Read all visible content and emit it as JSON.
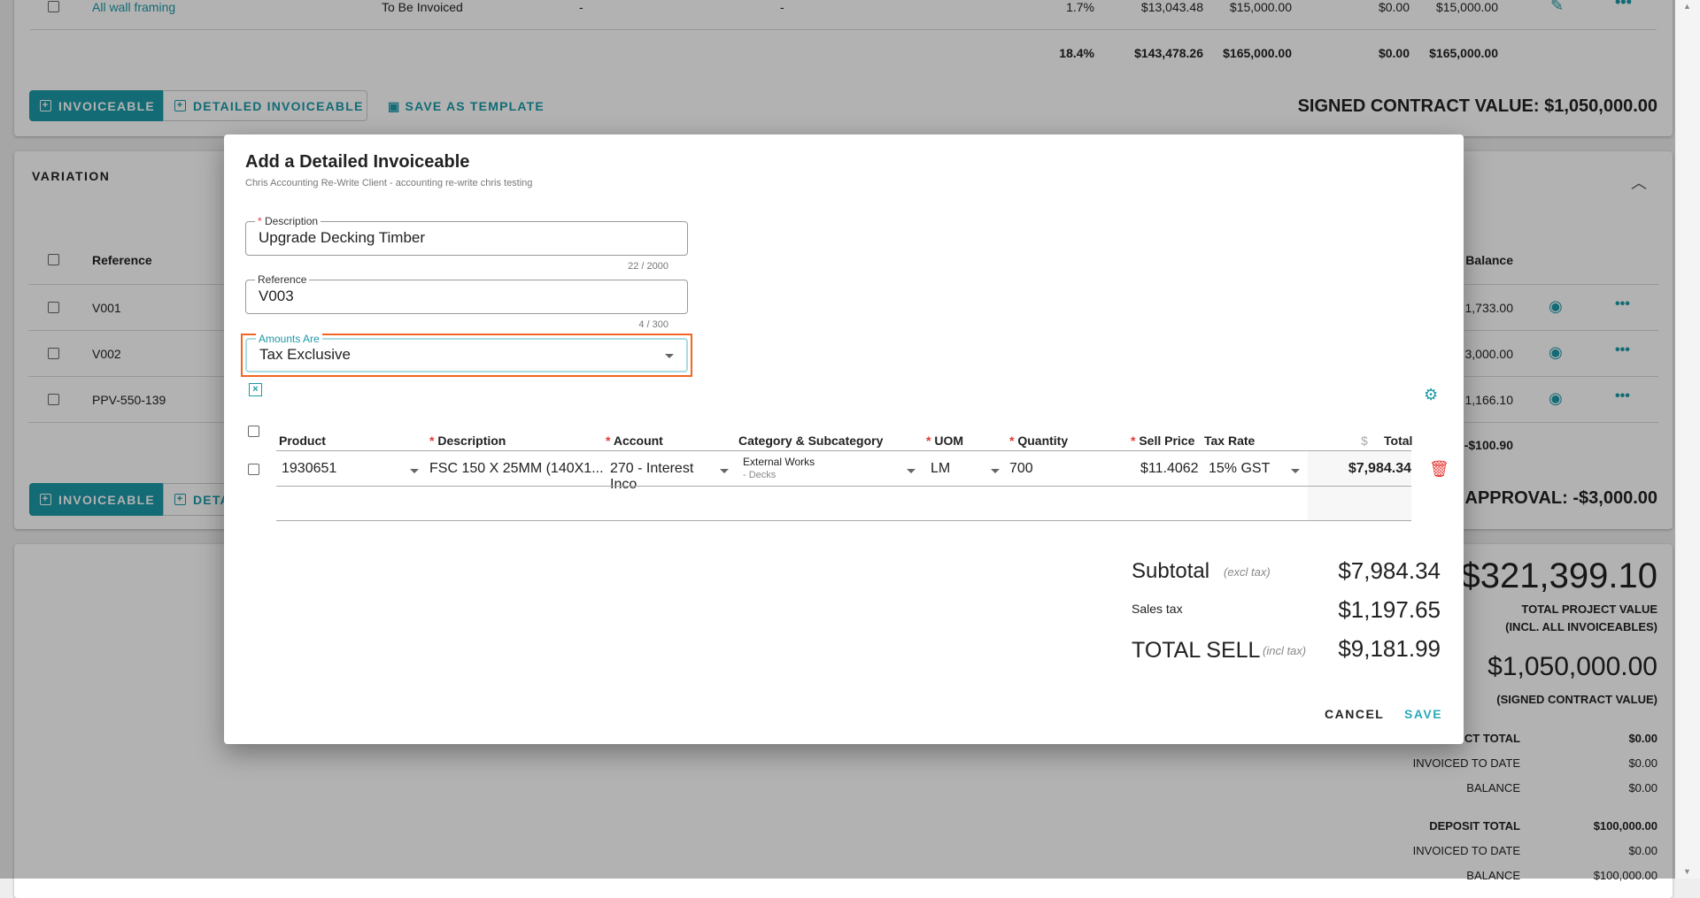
{
  "background": {
    "top_row": {
      "name": "All wall framing",
      "status": "To Be Invoiced",
      "col3": "-",
      "col4": "-",
      "pct": "1.7%",
      "cost": "$13,043.48",
      "sell": "$15,000.00",
      "invoiced": "$0.00",
      "balance": "$15,000.00"
    },
    "top_totals": {
      "pct": "18.4%",
      "cost": "$143,478.26",
      "sell": "$165,000.00",
      "invoiced": "$0.00",
      "balance": "$165,000.00"
    },
    "buttons": {
      "invoiceable": "INVOICEABLE",
      "detailed": "DETAILED INVOICEABLE",
      "detailed_partial": "DETA",
      "save_template": "SAVE AS TEMPLATE"
    },
    "signed_contract": "SIGNED CONTRACT VALUE: $1,050,000.00",
    "variation": {
      "title": "VARIATION",
      "headers": {
        "reference": "Reference",
        "balance": "Balance"
      },
      "rows": [
        {
          "ref": "V001",
          "balance": "1,733.00"
        },
        {
          "ref": "V002",
          "balance": "3,000.00"
        },
        {
          "ref": "PPV-550-139",
          "balance": "1,166.10"
        }
      ],
      "total": "-$100.90",
      "approval": "APPROVAL: -$3,000.00"
    },
    "summary": {
      "total_project_value": "$321,399.10",
      "tpv_label1": "TOTAL PROJECT VALUE",
      "tpv_label2": "(INCL. ALL INVOICEABLES)",
      "signed_value": "$1,050,000.00",
      "signed_label": "(SIGNED CONTRACT VALUE)",
      "rows": [
        {
          "label": "CT TOTAL",
          "value": "$0.00",
          "bold": true
        },
        {
          "label": "INVOICED TO DATE",
          "value": "$0.00"
        },
        {
          "label": "BALANCE",
          "value": "$0.00"
        },
        {
          "label": "DEPOSIT TOTAL",
          "value": "$100,000.00",
          "bold": true
        },
        {
          "label": "INVOICED TO DATE",
          "value": "$0.00"
        },
        {
          "label": "BALANCE",
          "value": "$100,000.00"
        }
      ]
    }
  },
  "modal": {
    "title": "Add a Detailed Invoiceable",
    "subtitle": "Chris Accounting Re-Write Client - accounting re-write chris testing",
    "description": {
      "label": "Description",
      "value": "Upgrade Decking Timber",
      "counter": "22 / 2000"
    },
    "reference": {
      "label": "Reference",
      "value": "V003",
      "counter": "4 / 300"
    },
    "amounts_are": {
      "label": "Amounts Are",
      "value": "Tax Exclusive"
    },
    "table": {
      "headers": {
        "product": "Product",
        "description": "Description",
        "account": "Account",
        "category": "Category & Subcategory",
        "uom": "UOM",
        "quantity": "Quantity",
        "sell_price": "Sell Price",
        "tax_rate": "Tax Rate",
        "currency": "$",
        "total": "Total"
      },
      "row": {
        "product": "1930651",
        "description": "FSC 150 X 25MM (140X1...",
        "account": "270 - Interest Inco",
        "category": "External Works",
        "subcategory": "- Decks",
        "uom": "LM",
        "quantity": "700",
        "sell_price": "$11.4062",
        "tax_rate": "15% GST",
        "total": "$7,984.34"
      }
    },
    "totals": {
      "subtotal_label": "Subtotal",
      "subtotal_note": "(excl tax)",
      "subtotal": "$7,984.34",
      "tax_label": "Sales tax",
      "tax": "$1,197.65",
      "total_label": "TOTAL SELL",
      "total_note": "(incl tax)",
      "total": "$9,181.99"
    },
    "cancel": "CANCEL",
    "save": "SAVE"
  },
  "colors": {
    "accent": "#1a9aa8",
    "highlight": "#f26522",
    "danger": "#e53935"
  }
}
